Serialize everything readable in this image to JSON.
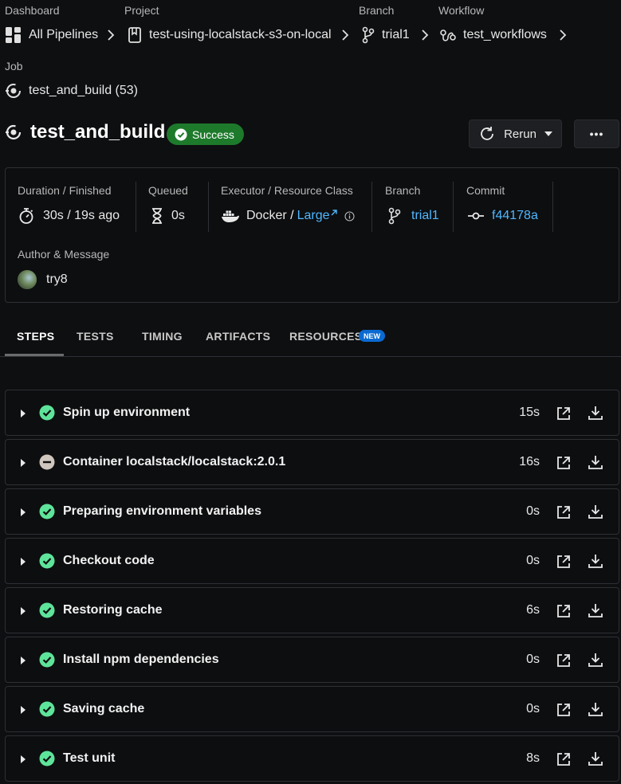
{
  "breadcrumb": {
    "dashboard_label": "Dashboard",
    "dashboard_value": "All Pipelines",
    "project_label": "Project",
    "project_value": "test-using-localstack-s3-on-local",
    "branch_label": "Branch",
    "branch_value": "trial1",
    "workflow_label": "Workflow",
    "workflow_value": "test_workflows",
    "job_label": "Job",
    "job_value": "test_and_build (53)"
  },
  "job": {
    "title": "test_and_build",
    "status": "Success",
    "rerun_label": "Rerun",
    "more_label": "•••"
  },
  "info": {
    "duration_label": "Duration / Finished",
    "duration_value": "30s / 19s ago",
    "queued_label": "Queued",
    "queued_value": "0s",
    "executor_label": "Executor / Resource Class",
    "executor_value": "Docker /",
    "resource_value": "Large",
    "branch_label": "Branch",
    "branch_value": "trial1",
    "commit_label": "Commit",
    "commit_value": "f44178a",
    "author_label": "Author & Message",
    "author_value": "try8"
  },
  "tabs": {
    "steps": "STEPS",
    "tests": "TESTS",
    "timing": "TIMING",
    "artifacts": "ARTIFACTS",
    "resources": "RESOURCES",
    "new_badge": "NEW"
  },
  "steps": [
    {
      "title": "Spin up environment",
      "duration": "15s",
      "status": "success"
    },
    {
      "title": "Container localstack/localstack:2.0.1",
      "duration": "16s",
      "status": "neutral"
    },
    {
      "title": "Preparing environment variables",
      "duration": "0s",
      "status": "success"
    },
    {
      "title": "Checkout code",
      "duration": "0s",
      "status": "success"
    },
    {
      "title": "Restoring cache",
      "duration": "6s",
      "status": "success"
    },
    {
      "title": "Install npm dependencies",
      "duration": "0s",
      "status": "success"
    },
    {
      "title": "Saving cache",
      "duration": "0s",
      "status": "success"
    },
    {
      "title": "Test unit",
      "duration": "8s",
      "status": "success"
    }
  ],
  "colors": {
    "success": "#5ee49a",
    "neutral": "#cfc6bd",
    "link": "#4fb8ff",
    "badge": "#1d7a2b"
  }
}
